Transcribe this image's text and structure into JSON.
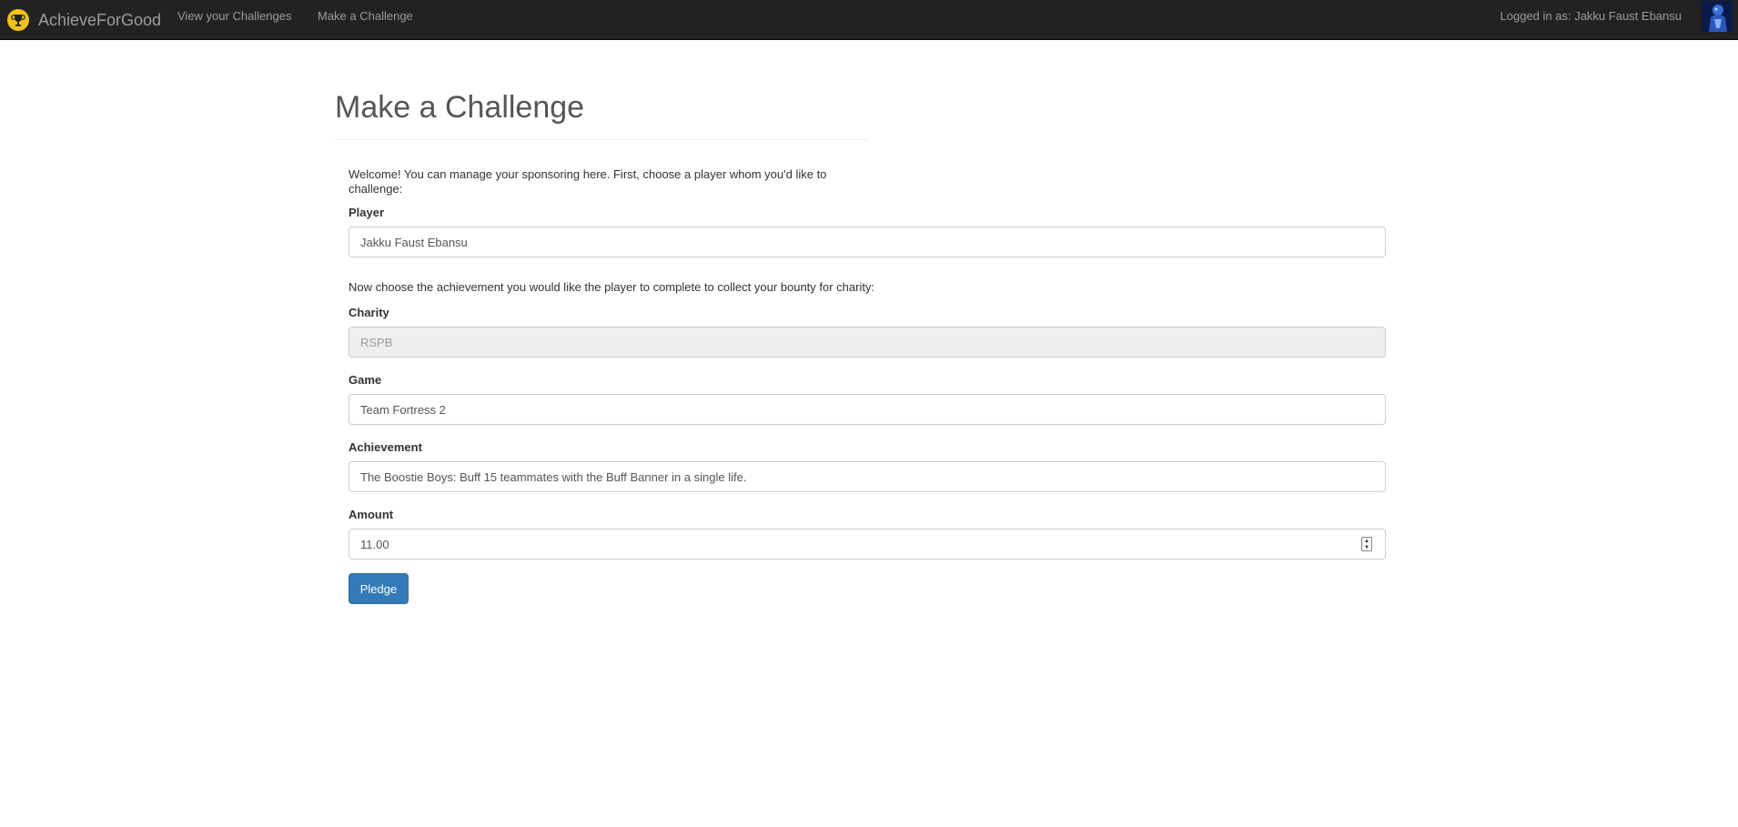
{
  "nav": {
    "brand": "AchieveForGood",
    "links": [
      {
        "label": "View your Challenges"
      },
      {
        "label": "Make a Challenge"
      }
    ],
    "user_text": "Logged in as: Jakku Faust Ebansu"
  },
  "page": {
    "title": "Make a Challenge",
    "intro": "Welcome! You can manage your sponsoring here. First, choose a player whom you'd like to challenge:",
    "intro2": "Now choose the achievement you would like the player to complete to collect your bounty for charity:"
  },
  "form": {
    "player_label": "Player",
    "player_value": "Jakku Faust Ebansu",
    "charity_label": "Charity",
    "charity_value": "RSPB",
    "game_label": "Game",
    "game_value": "Team Fortress 2",
    "achievement_label": "Achievement",
    "achievement_value": "The Boostie Boys: Buff 15 teammates with the Buff Banner in a single life.",
    "amount_label": "Amount",
    "amount_value": "11.00",
    "submit_label": "Pledge"
  },
  "icons": {
    "brand_logo": "trophy-icon",
    "avatar": "user-avatar"
  },
  "colors": {
    "navbar_bg": "#222222",
    "primary_button": "#337ab7",
    "brand_logo": "#f2c21b"
  }
}
